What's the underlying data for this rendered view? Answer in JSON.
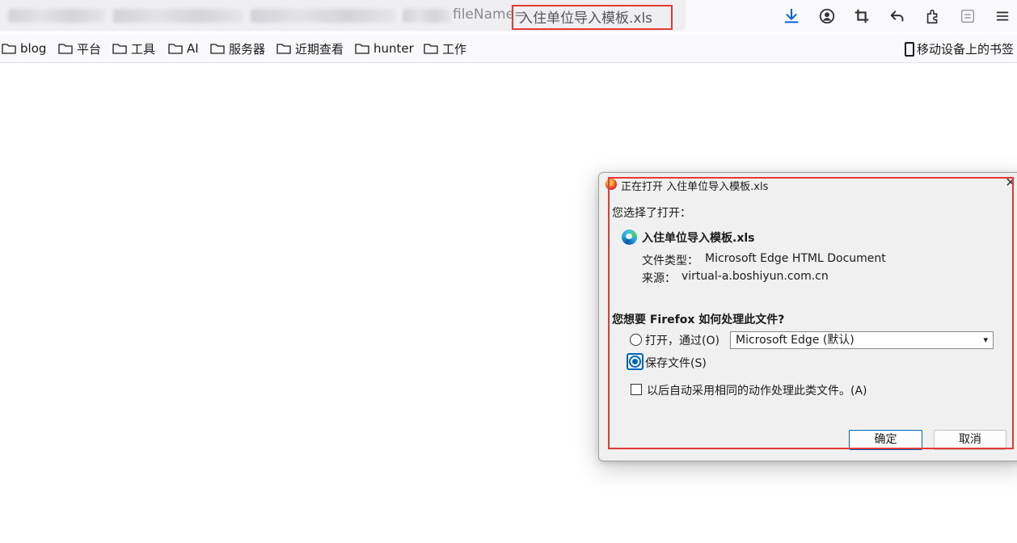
{
  "urlbar": {
    "visible_url_fragment": "fileName=",
    "highlighted_filename": "入住单位导入模板.xls"
  },
  "toolbar_icons": [
    "download-icon",
    "account-icon",
    "screenshot-crop-icon",
    "back-arrow-icon",
    "extensions-icon",
    "reader-view-icon",
    "menu-icon"
  ],
  "bookmarks": {
    "items": [
      {
        "label": "blog"
      },
      {
        "label": "平台"
      },
      {
        "label": "工具"
      },
      {
        "label": "AI"
      },
      {
        "label": "服务器"
      },
      {
        "label": "近期查看"
      },
      {
        "label": "hunter"
      },
      {
        "label": "工作"
      }
    ],
    "mobile_label": "移动设备上的书签"
  },
  "dialog": {
    "title": "正在打开 入住单位导入模板.xls",
    "close_glyph": "✕",
    "intro": "您选择了打开：",
    "file_name": "入住单位导入模板.xls",
    "type_label": "文件类型：",
    "type_value": "Microsoft Edge HTML Document",
    "source_label": "来源：",
    "source_value": "virtual-a.boshiyun.com.cn",
    "question": "您想要 Firefox 如何处理此文件?",
    "open_with_label": "打开，通过(O)",
    "open_with_app": "Microsoft Edge (默认)",
    "save_file_label": "保存文件(S)",
    "remember_label": "以后自动采用相同的动作处理此类文件。(A)",
    "ok_label": "确定",
    "cancel_label": "取消",
    "selected_option": "save"
  }
}
